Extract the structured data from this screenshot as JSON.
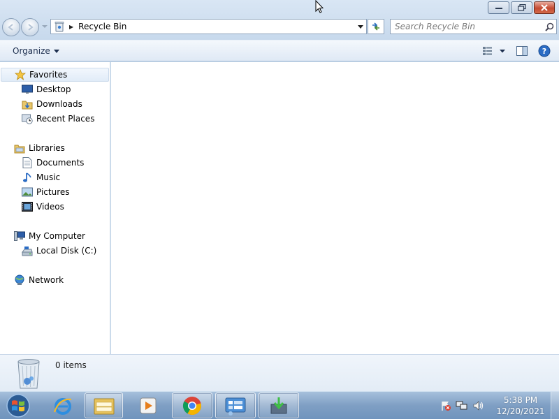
{
  "window": {
    "address_path": "Recycle Bin",
    "search_placeholder": "Search Recycle Bin"
  },
  "toolbar": {
    "organize_label": "Organize"
  },
  "navigation": {
    "favorites": {
      "label": "Favorites",
      "items": [
        {
          "label": "Desktop",
          "icon": "desktop-icon"
        },
        {
          "label": "Downloads",
          "icon": "downloads-folder-icon"
        },
        {
          "label": "Recent Places",
          "icon": "recent-places-icon"
        }
      ]
    },
    "libraries": {
      "label": "Libraries",
      "items": [
        {
          "label": "Documents",
          "icon": "documents-icon"
        },
        {
          "label": "Music",
          "icon": "music-icon"
        },
        {
          "label": "Pictures",
          "icon": "pictures-icon"
        },
        {
          "label": "Videos",
          "icon": "videos-icon"
        }
      ]
    },
    "computer": {
      "label": "My Computer",
      "items": [
        {
          "label": "Local Disk (C:)",
          "icon": "local-disk-icon"
        }
      ]
    },
    "network": {
      "label": "Network"
    }
  },
  "details": {
    "item_count": "0 items"
  },
  "taskbar": {
    "time": "5:38 PM",
    "date": "12/20/2021",
    "pinned": [
      "internet-explorer-icon",
      "file-explorer-icon",
      "media-player-icon",
      "chrome-icon",
      "control-panel-icon",
      "installer-icon"
    ]
  },
  "colors": {
    "window_frame": "#c9dcef",
    "close_button": "#c44a32",
    "taskbar": "#7f9fc4",
    "selection_highlight": "#e1ecf8"
  }
}
